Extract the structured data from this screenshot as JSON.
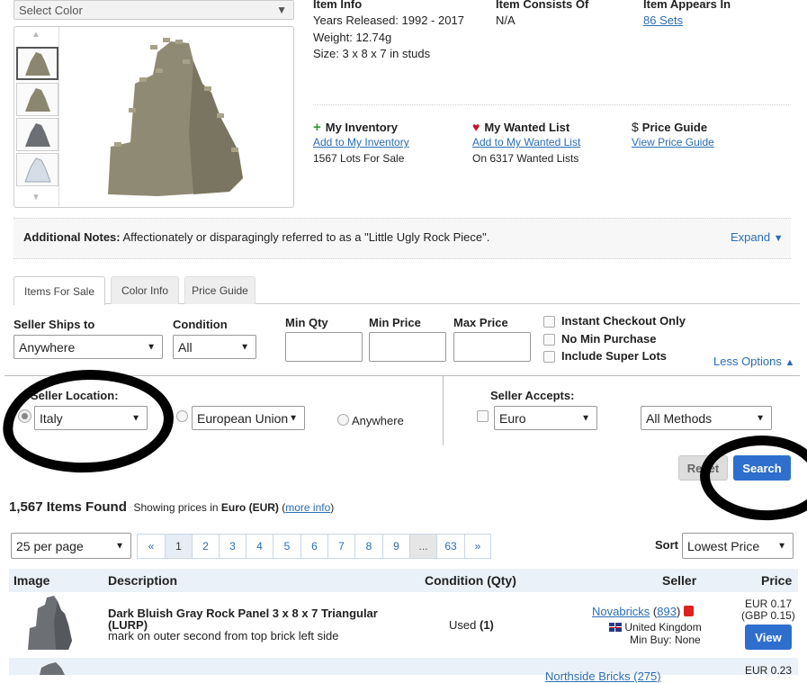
{
  "color_select": {
    "label": "Select Color"
  },
  "item_info": {
    "heading": "Item Info",
    "years": "Years Released: 1992 - 2017",
    "weight": "Weight: 12.74g",
    "size": "Size: 3 x 8 x 7 in studs"
  },
  "consists_of": {
    "heading": "Item Consists Of",
    "value": "N/A"
  },
  "appears_in": {
    "heading": "Item Appears In",
    "value": "86 Sets"
  },
  "inventory": {
    "title": "My Inventory",
    "link": "Add to My Inventory",
    "count": "1567 Lots For Sale"
  },
  "wanted": {
    "title": "My Wanted List",
    "link": "Add to My Wanted List",
    "count": "On 6317 Wanted Lists"
  },
  "price_guide": {
    "symbol": "$",
    "title": "Price Guide",
    "link": "View Price Guide"
  },
  "notes": {
    "label": "Additional Notes:",
    "text": "Affectionately or disparagingly referred to as a \"Little Ugly Rock Piece\".",
    "expand": "Expand"
  },
  "tabs": [
    {
      "label": "Items For Sale"
    },
    {
      "label": "Color Info"
    },
    {
      "label": "Price Guide"
    }
  ],
  "filters": {
    "ships_to_label": "Seller Ships to",
    "ships_to_value": "Anywhere",
    "condition_label": "Condition",
    "condition_value": "All",
    "min_qty_label": "Min Qty",
    "min_price_label": "Min Price",
    "max_price_label": "Max Price",
    "instant_checkout": "Instant Checkout Only",
    "no_min_purchase": "No Min Purchase",
    "include_super_lots": "Include Super Lots",
    "less_options": "Less Options",
    "location_label": "Seller Location:",
    "location_value": "Italy",
    "region_value": "European Union",
    "anywhere_label": "Anywhere",
    "accepts_label": "Seller Accepts:",
    "currency_value": "Euro",
    "methods_value": "All Methods",
    "reset": "Reset",
    "search": "Search"
  },
  "results": {
    "count": "1,567 Items Found",
    "showing_prefix": "Showing prices in",
    "currency": "Euro (EUR)",
    "more_info": "more info",
    "per_page": "25 per page",
    "pages": [
      "«",
      "1",
      "2",
      "3",
      "4",
      "5",
      "6",
      "7",
      "8",
      "9",
      "...",
      "63",
      "»"
    ],
    "sort_label": "Sort",
    "sort_value": "Lowest Price"
  },
  "table": {
    "headers": {
      "image": "Image",
      "description": "Description",
      "condition": "Condition (Qty)",
      "seller": "Seller",
      "price": "Price"
    },
    "rows": [
      {
        "title": "Dark Bluish Gray Rock Panel 3 x 8 x 7 Triangular (LURP)",
        "note": "mark on outer second from top brick left side",
        "condition": "Used",
        "qty": "(1)",
        "seller": "Novabricks",
        "feedback": "893",
        "country": "United Kingdom",
        "min_buy": "Min Buy: None",
        "price": "EUR 0.17",
        "price_alt": "(GBP 0.15)",
        "view": "View"
      },
      {
        "seller_partial": "Northside Bricks (275)",
        "price": "EUR 0.23"
      }
    ]
  },
  "colors": {
    "accent": "#2a6db5",
    "button": "#2e6fcd",
    "wanted_heart": "#c8102e",
    "plus": "#2e9b2e",
    "part_tan": "#8b8670",
    "part_gray": "#6c6f74"
  }
}
